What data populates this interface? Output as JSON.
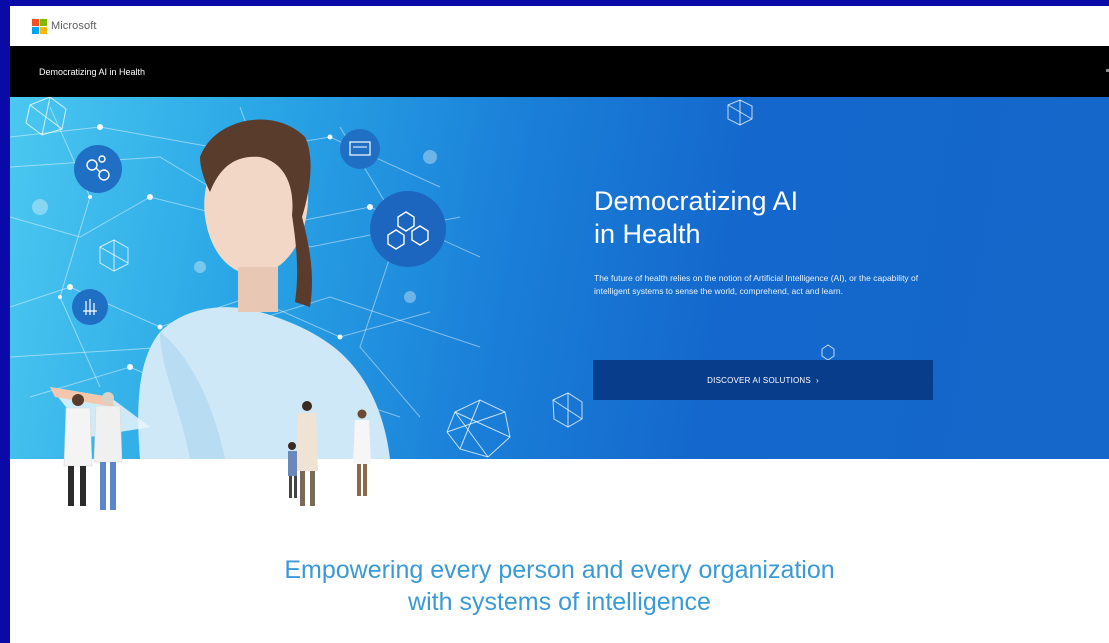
{
  "header": {
    "brand": "Microsoft",
    "logo_colors": [
      "#f25022",
      "#7fba00",
      "#00a4ef",
      "#ffb900"
    ]
  },
  "nav": {
    "title": "Democratizing AI in Health"
  },
  "hero": {
    "title": "Democratizing AI\nin Health",
    "description": "The future of health relies on the notion of Artificial Intelligence (AI), or the capability of intelligent systems to sense the world, comprehend, act and learn.",
    "cta_label": "DISCOVER AI SOLUTIONS",
    "cta_chevron": "›",
    "background_color": "#1567c9",
    "cta_color": "#083d8c"
  },
  "tagline": {
    "text": "Empowering every person and every organization\nwith systems of intelligence",
    "color": "#3a9ad6"
  },
  "icons": [
    "microsoft-logo-icon",
    "molecule-icon",
    "hexagon-network-icon",
    "hand-touch-icon",
    "device-icon",
    "geodesic-sphere-icon",
    "chevron-right-icon"
  ]
}
